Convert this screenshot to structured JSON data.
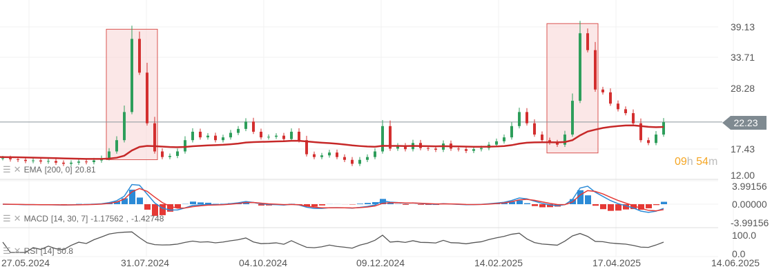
{
  "chart_data": {
    "type": "candlestick",
    "price_axis": {
      "labels": [
        "39.13",
        "33.71",
        "28.28",
        "22.23",
        "17.43",
        "12.00"
      ],
      "range": [
        12.0,
        39.13
      ]
    },
    "last_price": "22.23",
    "countdown": {
      "hours": "09",
      "h": "h",
      "minutes": "54",
      "m": "m"
    },
    "closes": [
      15.8,
      15.6,
      15.5,
      15.3,
      15.4,
      15.2,
      15.3,
      15.0,
      14.8,
      15.0,
      15.2,
      15.1,
      15.4,
      15.8,
      17,
      19,
      24,
      37,
      31,
      22,
      17,
      16,
      16.2,
      17,
      19,
      20.5,
      19.5,
      19.8,
      19,
      19.5,
      20.3,
      21,
      22.3,
      20.5,
      19.5,
      19.6,
      19.8,
      19.2,
      20.5,
      19,
      16.5,
      16,
      16.3,
      16.8,
      16,
      15.5,
      14.8,
      15.5,
      16,
      17,
      21.5,
      17.5,
      18,
      17.4,
      18.5,
      17.6,
      17.5,
      17.3,
      18.4,
      17.5,
      17.4,
      17.1,
      17.4,
      17.6,
      18.2,
      18.8,
      19.5,
      21.5,
      24,
      22,
      20,
      19,
      18.6,
      18.2,
      20,
      26,
      38,
      35,
      28,
      27.5,
      25.5,
      24.5,
      23.8,
      22,
      19,
      18.5,
      20,
      22.2
    ],
    "ema": {
      "label": "EMA",
      "params": "[200, 0]",
      "value": "20.81"
    },
    "macd": {
      "label": "MACD",
      "params": "[14, 30, 7]",
      "value1": "-1.17562",
      "value2": "-1.42748",
      "axis": [
        "3.99156",
        "0.00000",
        "-3.99156"
      ],
      "range": [
        -3.99156,
        3.99156
      ]
    },
    "rsi": {
      "label": "RSI",
      "params": "[14]",
      "value": "50.8",
      "axis": [
        "100.0",
        "0.0"
      ]
    },
    "x_labels": [
      "27.05.2024",
      "31.07.2024",
      "04.10.2024",
      "09.12.2024",
      "14.02.2025",
      "17.04.2025",
      "14.06.2025"
    ],
    "highlights": [
      {
        "from_index": 14,
        "to_index": 20
      },
      {
        "from_index": 72,
        "to_index": 78
      }
    ],
    "colors": {
      "up": "#2e9e5b",
      "down": "#d32f2f",
      "ema": "#c62828",
      "macd": "#2b8ad6",
      "signal": "#e53935",
      "rsi": "#555555",
      "highlight": "#f8d7d7"
    }
  }
}
